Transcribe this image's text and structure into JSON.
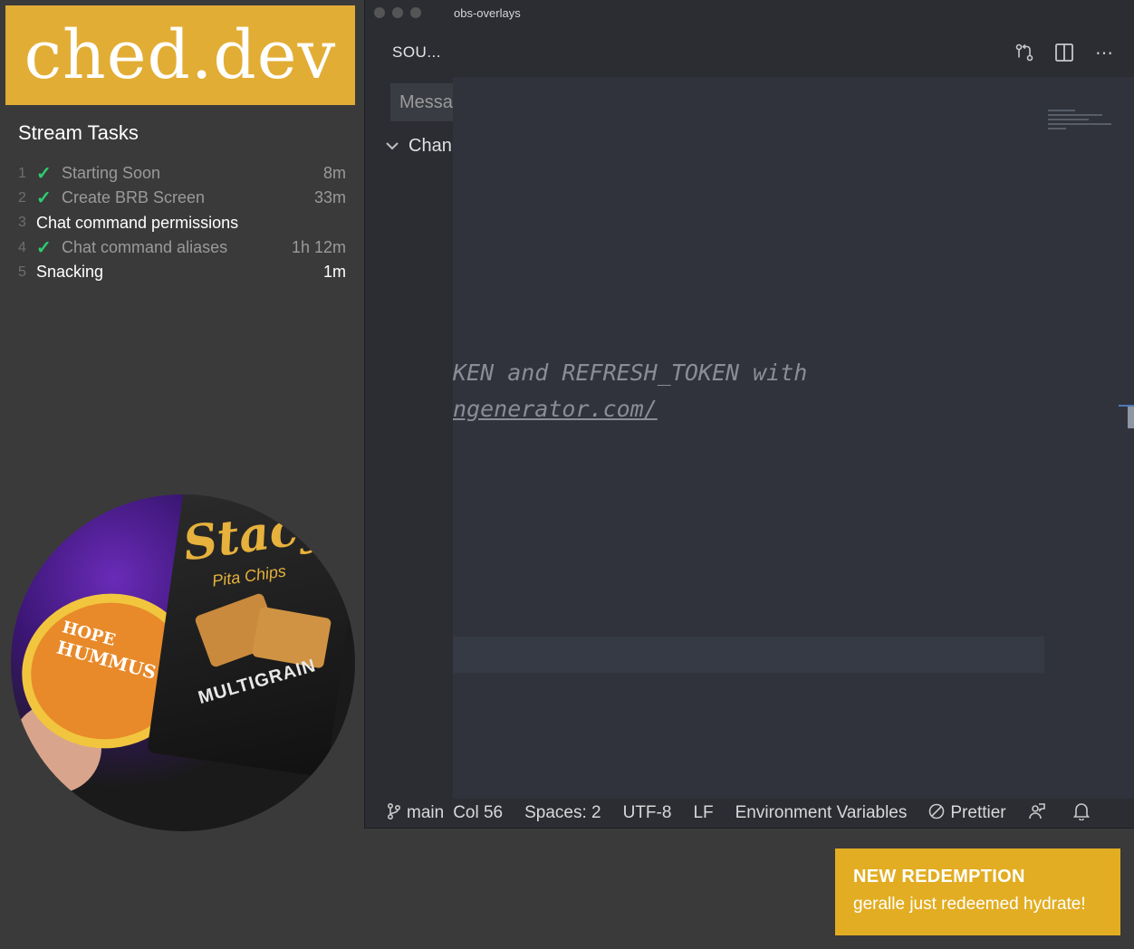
{
  "brand": {
    "text": "ched.dev",
    "color": "#e2ad35"
  },
  "tasks": {
    "title": "Stream Tasks",
    "items": [
      {
        "num": "1",
        "done": true,
        "label": "Starting Soon",
        "time": "8m"
      },
      {
        "num": "2",
        "done": true,
        "label": "Create BRB Screen",
        "time": "33m"
      },
      {
        "num": "3",
        "done": false,
        "label": "Chat command permissions",
        "time": ""
      },
      {
        "num": "4",
        "done": true,
        "label": "Chat command aliases",
        "time": "1h 12m"
      },
      {
        "num": "5",
        "done": false,
        "label": "Snacking",
        "time": "1m"
      }
    ]
  },
  "webcam": {
    "hummus_brand": "HOPE",
    "hummus_product": "HUMMUS",
    "chips_brand": "Stacy",
    "chips_sub": "Pita Chips",
    "chips_variety": "MULTIGRAIN"
  },
  "editor": {
    "window_title": "obs-overlays",
    "sidebar_title": "SOU...",
    "message_placeholder": "Messa",
    "changes_label": "Chan",
    "code_lines": [
      "KEN and REFRESH_TOKEN with",
      "ngenerator.com/"
    ],
    "icons": [
      "source-control-icon",
      "split-editor-icon",
      "more-icon"
    ]
  },
  "statusbar": {
    "branch": "main",
    "col": "Col 56",
    "spaces": "Spaces: 2",
    "encoding": "UTF-8",
    "eol": "LF",
    "language": "Environment Variables",
    "formatter": "Prettier"
  },
  "toast": {
    "title": "NEW REDEMPTION",
    "message": "geralle just redeemed hydrate!",
    "color": "#e2ad22"
  }
}
